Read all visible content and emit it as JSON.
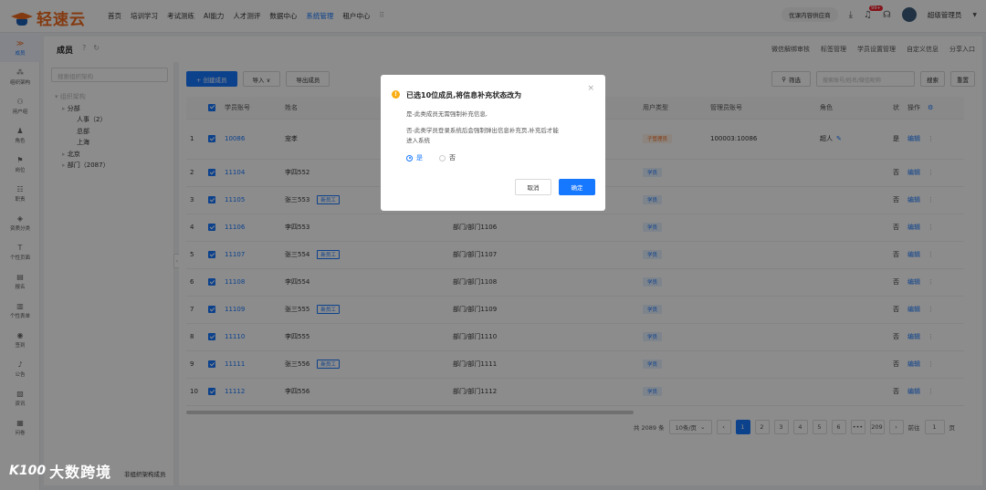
{
  "brand": {
    "name": "轻速云"
  },
  "nav": [
    "首页",
    "培训学习",
    "考试测练",
    "AI能力",
    "人才测评",
    "数据中心",
    "系统管理",
    "租户中心"
  ],
  "nav_active": 6,
  "topright": {
    "pill": "优课内容供应商",
    "badge": "99+",
    "user": "超级管理员"
  },
  "sidebar": [
    {
      "label": "成员",
      "icon": "≫"
    },
    {
      "label": "组织架构",
      "icon": "⁂"
    },
    {
      "label": "用户组",
      "icon": "⚇"
    },
    {
      "label": "角色",
      "icon": "♟"
    },
    {
      "label": "岗位",
      "icon": "⚑"
    },
    {
      "label": "职责",
      "icon": "☷"
    },
    {
      "label": "资质分类",
      "icon": "◈"
    },
    {
      "label": "个性页面",
      "icon": "T"
    },
    {
      "label": "报名",
      "icon": "▤"
    },
    {
      "label": "个性表单",
      "icon": "▥"
    },
    {
      "label": "签到",
      "icon": "◉"
    },
    {
      "label": "公告",
      "icon": "♪"
    },
    {
      "label": "资讯",
      "icon": "▧"
    },
    {
      "label": "问卷",
      "icon": "▦"
    }
  ],
  "page": {
    "title": "成员",
    "links": [
      "微信解绑审核",
      "标签管理",
      "学员设置管理",
      "自定义信息",
      "分享入口"
    ]
  },
  "org": {
    "search_placeholder": "搜索组织架构",
    "tree": [
      "组织架构",
      "分部",
      "人事（2）",
      "总部",
      "上海",
      "北京",
      "部门（2087）"
    ],
    "footer": "非组织架构成员"
  },
  "toolbar": {
    "create": "+ 创建成员",
    "import": "导入 ∨",
    "export": "导出成员",
    "filter": "筛选",
    "search_placeholder": "搜索账号/姓名/微信昵称",
    "search": "搜索",
    "reset": "重置"
  },
  "columns": [
    "学员账号",
    "姓名",
    "用户类型",
    "管理员账号",
    "角色",
    "状",
    "操作"
  ],
  "rows": [
    {
      "no": "1",
      "acct": "10086",
      "name": "宠孝",
      "newtag": "",
      "dept": "",
      "type": "子管理员",
      "admin": "100003:10086",
      "role": "超人",
      "st": "是"
    },
    {
      "no": "2",
      "acct": "11104",
      "name": "李四552",
      "newtag": "",
      "dept": "",
      "type": "学员",
      "admin": "",
      "role": "",
      "st": "否"
    },
    {
      "no": "3",
      "acct": "11105",
      "name": "张三553",
      "newtag": "新员工",
      "dept": "",
      "type": "学员",
      "admin": "",
      "role": "",
      "st": "否"
    },
    {
      "no": "4",
      "acct": "11106",
      "name": "李四553",
      "newtag": "",
      "dept": "部门/部门1106",
      "type": "学员",
      "admin": "",
      "role": "",
      "st": "否"
    },
    {
      "no": "5",
      "acct": "11107",
      "name": "张三554",
      "newtag": "新员工",
      "dept": "部门/部门1107",
      "type": "学员",
      "admin": "",
      "role": "",
      "st": "否"
    },
    {
      "no": "6",
      "acct": "11108",
      "name": "李四554",
      "newtag": "",
      "dept": "部门/部门1108",
      "type": "学员",
      "admin": "",
      "role": "",
      "st": "否"
    },
    {
      "no": "7",
      "acct": "11109",
      "name": "张三555",
      "newtag": "新员工",
      "dept": "部门/部门1109",
      "type": "学员",
      "admin": "",
      "role": "",
      "st": "否"
    },
    {
      "no": "8",
      "acct": "11110",
      "name": "李四555",
      "newtag": "",
      "dept": "部门/部门1110",
      "type": "学员",
      "admin": "",
      "role": "",
      "st": "否"
    },
    {
      "no": "9",
      "acct": "11111",
      "name": "张三556",
      "newtag": "新员工",
      "dept": "部门/部门1111",
      "type": "学员",
      "admin": "",
      "role": "",
      "st": "否"
    },
    {
      "no": "10",
      "acct": "11112",
      "name": "李四556",
      "newtag": "",
      "dept": "部门/部门1112",
      "type": "学员",
      "admin": "",
      "role": "",
      "st": "否"
    }
  ],
  "row_action": "编辑",
  "pager": {
    "total": "共 2089 条",
    "size": "10条/页",
    "pages": [
      "1",
      "2",
      "3",
      "4",
      "5",
      "6",
      "•••",
      "209"
    ],
    "goto": "前往",
    "goto_val": "1",
    "page_unit": "页"
  },
  "modal": {
    "title": "已选10位成员,将信息补充状态改为",
    "line1": "是-此类成员无需强制补充信息,",
    "line2": "否-此类学员登录系统后会强制弹出信息补充页,补充后才能",
    "line3": "进入系统",
    "opt_yes": "是",
    "opt_no": "否",
    "cancel": "取消",
    "ok": "确定"
  },
  "watermark": {
    "logo": "K100",
    "text": "大数跨境"
  }
}
